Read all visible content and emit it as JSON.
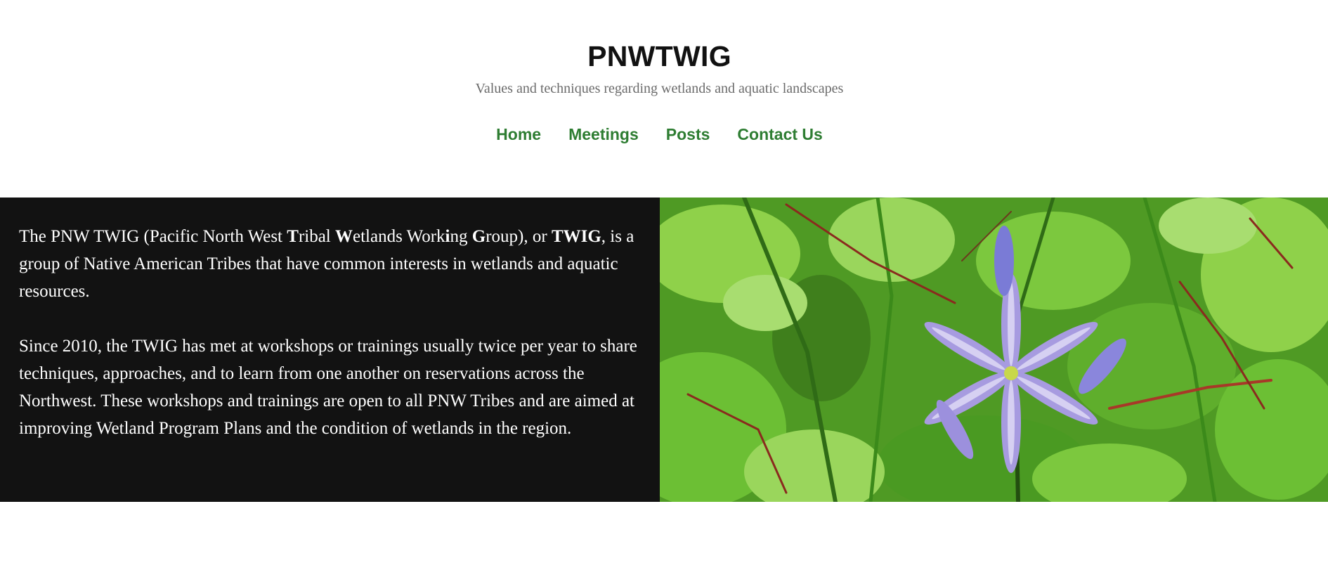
{
  "header": {
    "site_title": "PNWTWIG",
    "tagline": "Values and techniques regarding wetlands and aquatic landscapes"
  },
  "nav": {
    "items": [
      {
        "label": "Home"
      },
      {
        "label": "Meetings"
      },
      {
        "label": "Posts"
      },
      {
        "label": "Contact Us"
      }
    ]
  },
  "hero": {
    "paragraph1": {
      "t1": "The PNW TWIG (Pacific North West ",
      "b1": "T",
      "t2": "ribal ",
      "b2": "W",
      "t3": "etlands Work",
      "b3": "i",
      "t4": "ng ",
      "b4": "G",
      "t5": "roup), or ",
      "b5": "TWIG",
      "t6": ", is a group of Native American Tribes that have common interests in wetlands and aquatic resources."
    },
    "paragraph2": "Since 2010, the TWIG has met at workshops or trainings usually twice per year to share techniques, approaches, and to learn from one another on reservations across the Northwest. These workshops and trainings are open to all PNW Tribes and are aimed at improving Wetland Program Plans and the condition of wetlands in the region.",
    "image": {
      "icon": "camas-flower-photo",
      "colors": {
        "leaf_light": "#8fd14a",
        "leaf_mid": "#5fae2c",
        "leaf_dark": "#2f6b16",
        "stem_red": "#8a2a1e",
        "petal": "#a79be0",
        "petal_light": "#d6d0f2",
        "center": "#c8d84a"
      }
    }
  }
}
